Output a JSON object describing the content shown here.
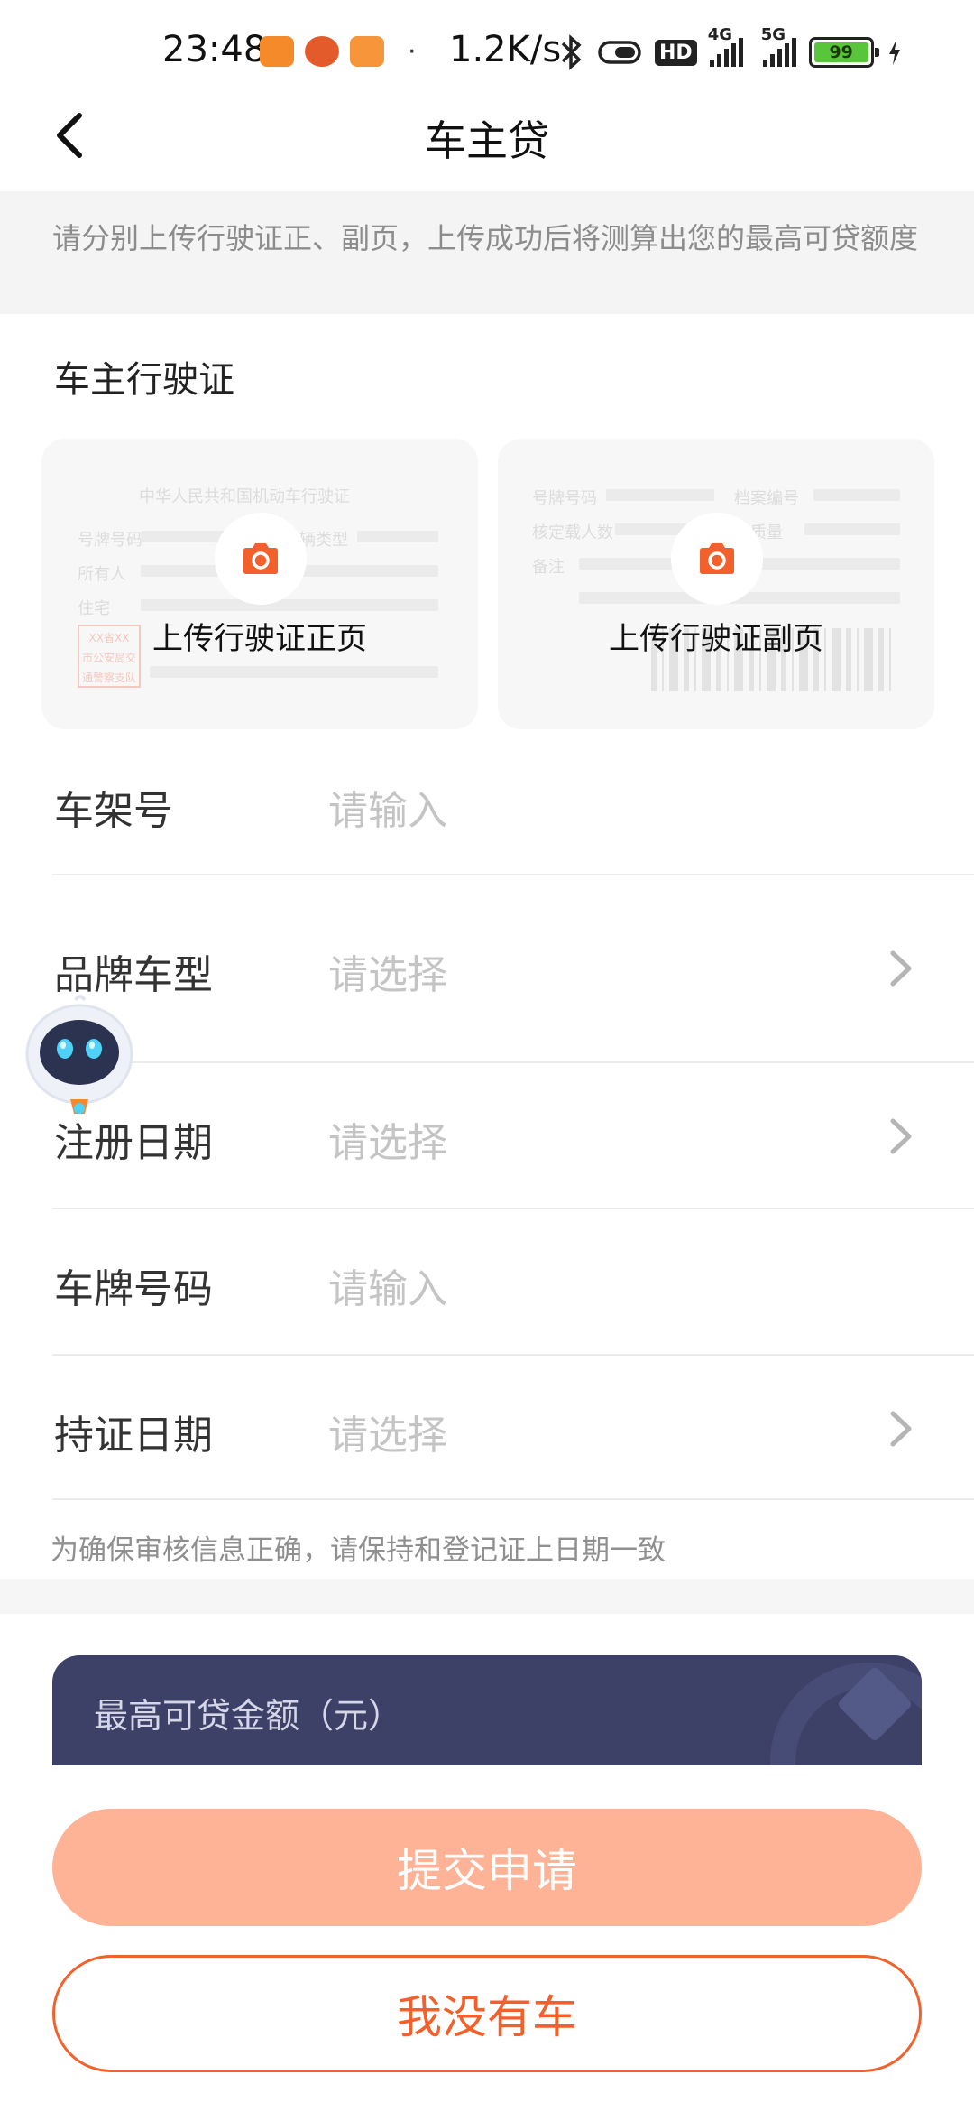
{
  "status_bar": {
    "time": "23:48",
    "net_speed": "1.2K/s",
    "signal_1_label": "4G",
    "signal_2_label": "5G",
    "hd_label": "HD",
    "battery": "99"
  },
  "header": {
    "title": "车主贷"
  },
  "notice": "请分别上传行驶证正、副页，上传成功后将测算出您的最高可贷额度",
  "section_title": "车主行驶证",
  "upload": {
    "front": {
      "label": "上传行驶证正页",
      "sample_title": "中华人民共和国机动车行驶证",
      "sample_fields": [
        "号牌号码",
        "所有人",
        "住宅"
      ],
      "sample_right": "车辆类型",
      "stamp_text": [
        "XX省XX",
        "市公安局交",
        "通警察支队"
      ]
    },
    "back": {
      "label": "上传行驶证副页",
      "sample_fields": [
        "号牌号码",
        "核定载人数",
        "备注"
      ],
      "sample_right": [
        "档案编号",
        "总质量"
      ]
    }
  },
  "form": {
    "rows": [
      {
        "label": "车架号",
        "placeholder": "请输入",
        "chevron": false
      },
      {
        "label": "品牌车型",
        "placeholder": "请选择",
        "chevron": true
      },
      {
        "label": "注册日期",
        "placeholder": "请选择",
        "chevron": true
      },
      {
        "label": "车牌号码",
        "placeholder": "请输入",
        "chevron": false
      },
      {
        "label": "持证日期",
        "placeholder": "请选择",
        "chevron": true
      }
    ],
    "hint": "为确保审核信息正确，请保持和登记证上日期一致"
  },
  "quota": {
    "label": "最高可贷金额（元）"
  },
  "buttons": {
    "submit": "提交申请",
    "no_car": "我没有车"
  },
  "colors": {
    "accent": "#f2612c",
    "submit_disabled": "#feb296",
    "quota_bg": "#3d4168"
  }
}
